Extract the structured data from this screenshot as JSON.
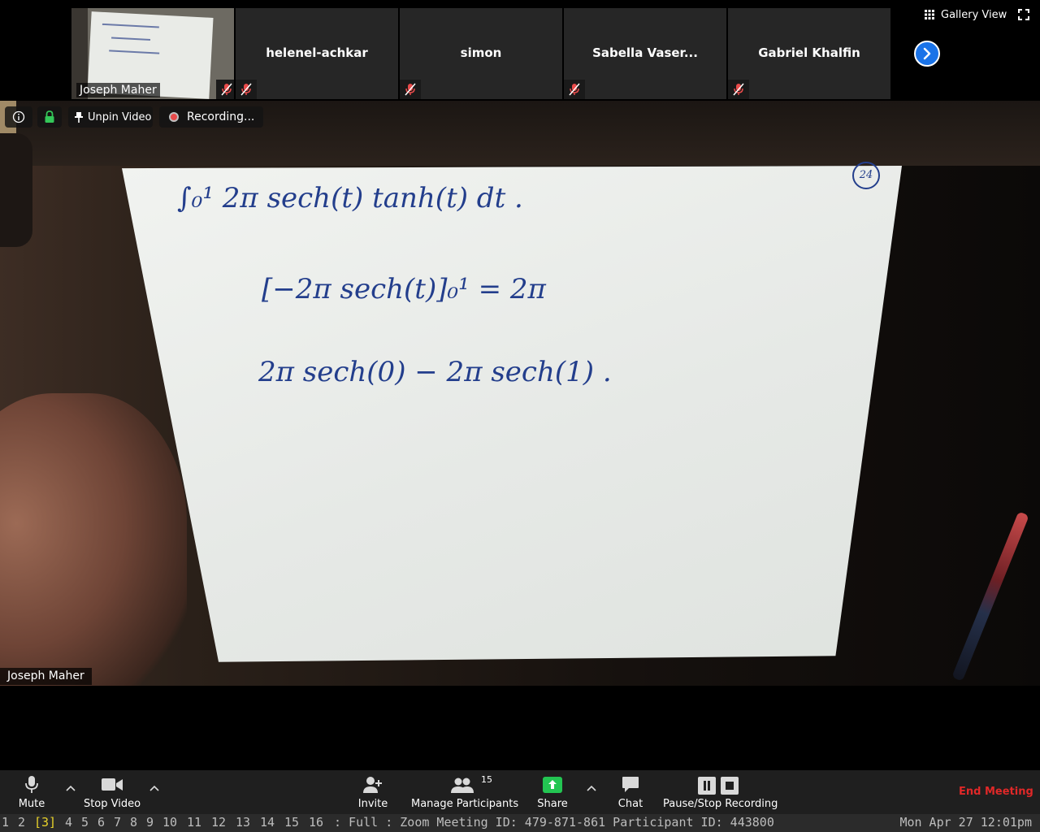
{
  "gallery": {
    "self": {
      "name": "Joseph Maher"
    },
    "participants": [
      {
        "name": "helenel-achkar"
      },
      {
        "name": "simon"
      },
      {
        "name": "Sabella Vaser..."
      },
      {
        "name": "Gabriel Khalfin"
      }
    ],
    "view_button": "Gallery View"
  },
  "main_video": {
    "participant_name": "Joseph Maher",
    "overlay": {
      "unpin_label": "Unpin Video",
      "recording_label": "Recording..."
    },
    "whiteboard": {
      "page_number": "24",
      "line1": "∫₀¹ 2π sech(t) tanh(t) dt .",
      "line2": "[−2π sech(t)]₀¹ =  2π",
      "line3": "2π sech(0) − 2π sech(1) ."
    }
  },
  "controls": {
    "mute": "Mute",
    "stop_video": "Stop Video",
    "invite": "Invite",
    "manage_participants": "Manage Participants",
    "participant_count": "15",
    "share": "Share",
    "chat": "Chat",
    "recording": "Pause/Stop Recording",
    "end_meeting": "End Meeting"
  },
  "statusbar": {
    "workspaces": [
      "1",
      "2",
      "[3]",
      "4",
      "5",
      "6",
      "7",
      "8",
      "9",
      "10",
      "11",
      "12",
      "13",
      "14",
      "15",
      "16"
    ],
    "status_text": ": Full : Zoom Meeting ID: 479-871-861 Participant ID: 443800",
    "clock": "Mon Apr 27 12:01pm"
  },
  "colors": {
    "accent_blue": "#1a73e8",
    "end_red": "#e02828",
    "ink": "#233e8c",
    "active_workspace": "#e8d22a"
  }
}
